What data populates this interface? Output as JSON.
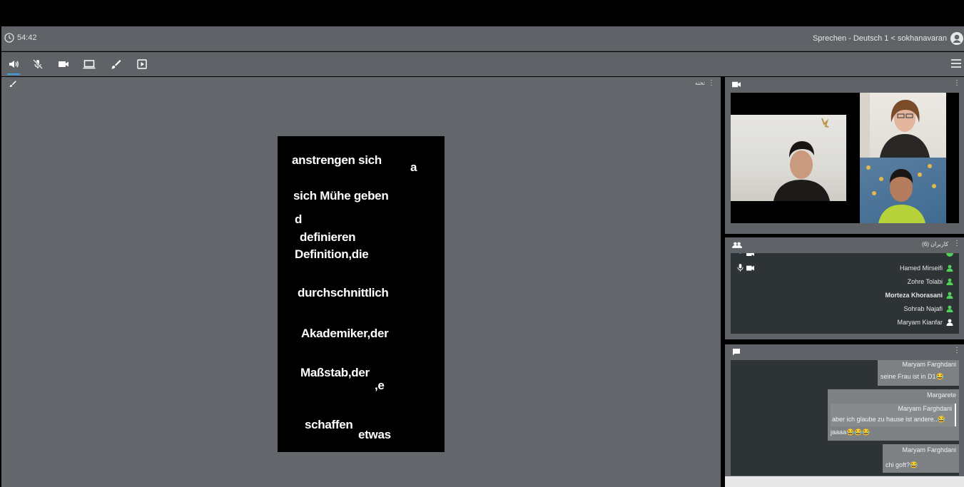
{
  "header": {
    "timer": "54:42",
    "title": "Sprechen - Deutsch 1 < sokhanavaran"
  },
  "toolbar": {
    "tools": [
      "speaker-icon",
      "mic-muted-icon",
      "camera-icon",
      "screen-share-icon",
      "brush-icon",
      "present-icon"
    ],
    "active": "speaker-icon"
  },
  "whiteboard": {
    "label": "تخته",
    "words": [
      "anstrengen sich",
      "a",
      "sich Mühe geben",
      "d",
      "definieren",
      "Definition,die",
      "durchschnittlich",
      "Akademiker,der",
      "Maßstab,der",
      ",e",
      "schaffen",
      "etwas"
    ]
  },
  "users": {
    "label": "کاربران (6)",
    "list": [
      {
        "name": "Hamed Mirseifi",
        "bold": false
      },
      {
        "name": "Zohre Tolabi",
        "bold": false
      },
      {
        "name": "Morteza Khorasani",
        "bold": true
      },
      {
        "name": "Sohrab Najafi",
        "bold": false
      },
      {
        "name": "Maryam Kianfar",
        "bold": false
      }
    ]
  },
  "chat": {
    "messages": [
      {
        "name": "Maryam Farghdani",
        "text": "seine Frau ist in D1😂"
      },
      {
        "name": "Margarete",
        "quote_name": "Maryam Farghdani",
        "quote_text": "aber ich glaube zu hause ist andere..😂",
        "text": "jaaaa😂😂😂"
      },
      {
        "name": "Maryam Farghdani",
        "text": "chi goft?😂"
      }
    ]
  },
  "colors": {
    "panel": "#5f6367",
    "dark": "#2e3336",
    "accent": "#3aa0e8",
    "online": "#4fd15a"
  }
}
